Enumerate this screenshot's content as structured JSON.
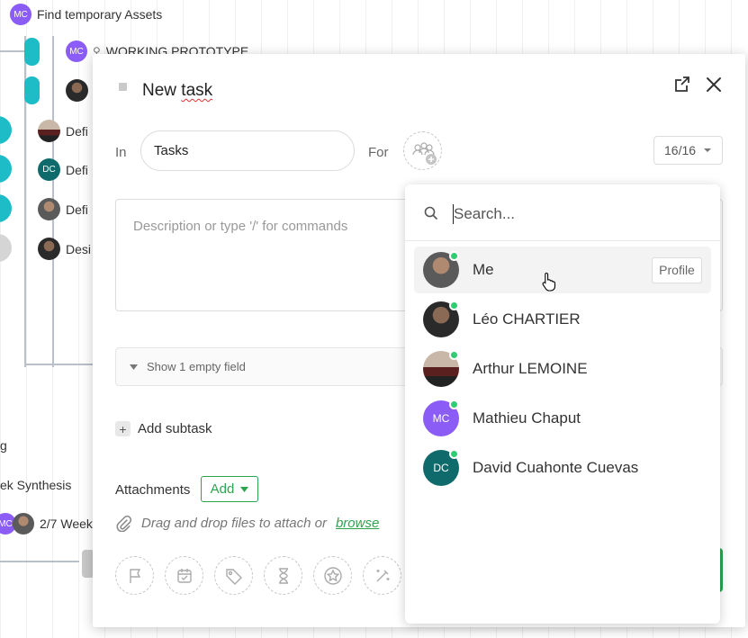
{
  "background": {
    "rows": [
      {
        "text": "Find temporary Assets",
        "avatar": "MC"
      },
      {
        "text": "WORKING PROTOTYPE",
        "avatar": "MC"
      },
      {
        "text": "Defi"
      },
      {
        "text": "Defi",
        "avatar": "DC"
      },
      {
        "text": "Defi"
      },
      {
        "text": "Desi"
      },
      {
        "text": "g"
      },
      {
        "text": "ek Synthesis"
      },
      {
        "text": "2/7 Week",
        "avatar": "MC"
      }
    ]
  },
  "modal": {
    "title_prefix": "New ",
    "title_word": "task",
    "in_label": "In",
    "in_value": "Tasks",
    "for_label": "For",
    "counter": "16/16",
    "description_placeholder": "Description or type '/' for commands",
    "show_empty_field": "Show 1 empty field",
    "add_subtask": "Add subtask",
    "attachments_label": "Attachments",
    "add_button": "Add",
    "drop_text": "Drag and drop files to attach or",
    "browse_link": "browse",
    "partial_text": "t"
  },
  "dropdown": {
    "search_placeholder": "Search...",
    "profile_button": "Profile",
    "users": [
      {
        "name": "Me",
        "initials": "",
        "avatar_style": "photo",
        "online": true
      },
      {
        "name": "Léo CHARTIER",
        "initials": "",
        "avatar_style": "photo",
        "online": true
      },
      {
        "name": "Arthur LEMOINE",
        "initials": "",
        "avatar_style": "car",
        "online": true
      },
      {
        "name": "Mathieu Chaput",
        "initials": "MC",
        "avatar_style": "purple",
        "online": true
      },
      {
        "name": "David Cuahonte Cuevas",
        "initials": "DC",
        "avatar_style": "teal",
        "online": true
      }
    ]
  },
  "colors": {
    "accent_green": "#2ea44f",
    "teal_pill": "#1ebcc7",
    "online": "#2fcc71",
    "mc_purple": "#8b5cf6",
    "dc_teal": "#0f6b6b"
  }
}
